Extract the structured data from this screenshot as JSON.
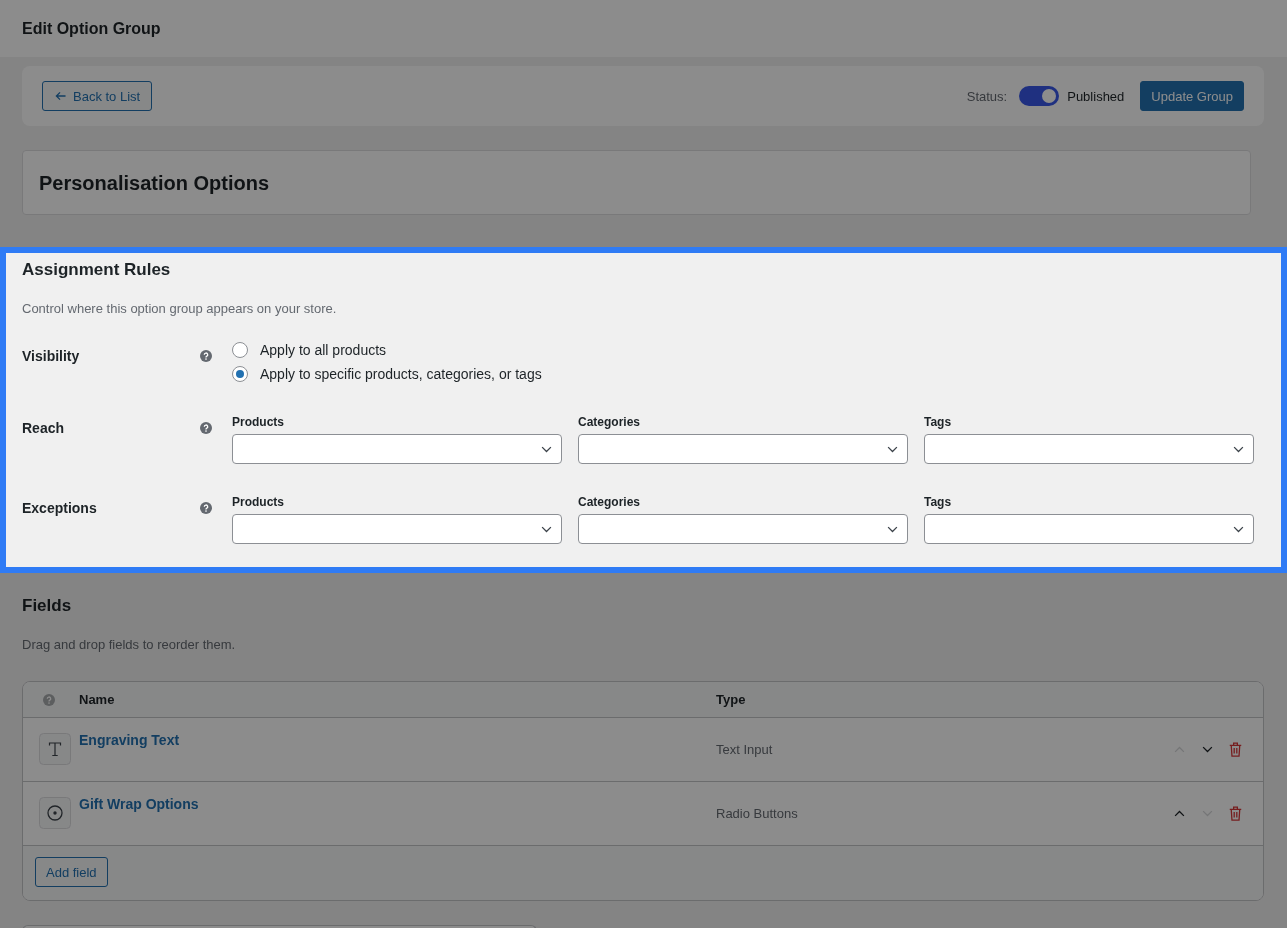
{
  "page_title": "Edit Option Group",
  "tour_overlay": true,
  "toolbar": {
    "back_button": "Back to List",
    "status_label": "Status:",
    "status_toggle": {
      "on": true
    },
    "status_text": "Published",
    "update_button": "Update Group"
  },
  "group_title": "Personalisation Options",
  "assignment_rules": {
    "highlighted": true,
    "title": "Assignment Rules",
    "description": "Control where this option group appears on your store.",
    "rows": [
      {
        "kind": "radio",
        "label": "Visibility",
        "options": [
          {
            "label": "Apply to all products",
            "selected": false
          },
          {
            "label": "Apply to specific products, categories, or tags",
            "selected": true
          }
        ]
      },
      {
        "kind": "selects",
        "label": "Reach",
        "selects": [
          {
            "label": "Products"
          },
          {
            "label": "Categories"
          },
          {
            "label": "Tags"
          }
        ]
      },
      {
        "kind": "selects",
        "label": "Exceptions",
        "selects": [
          {
            "label": "Products"
          },
          {
            "label": "Categories"
          },
          {
            "label": "Tags"
          }
        ]
      }
    ]
  },
  "fields": {
    "title": "Fields",
    "description": "Drag and drop fields to reorder them.",
    "columns": [
      "Name",
      "Type"
    ],
    "rows": [
      {
        "kind": "text",
        "name": "Engraving Text",
        "type": "Text Input",
        "move_up_disabled": true,
        "move_down_disabled": false
      },
      {
        "kind": "radio",
        "name": "Gift Wrap Options",
        "type": "Radio Buttons",
        "move_up_disabled": false,
        "move_down_disabled": true
      }
    ],
    "add_button": "Add field"
  }
}
